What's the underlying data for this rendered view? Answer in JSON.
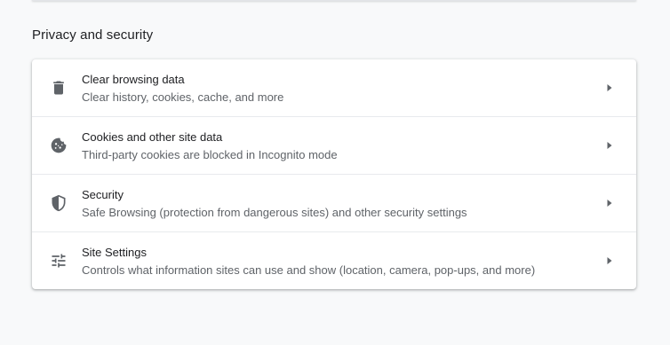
{
  "section": {
    "title": "Privacy and security"
  },
  "rows": [
    {
      "icon": "trash-icon",
      "label": "Clear browsing data",
      "sublabel": "Clear history, cookies, cache, and more"
    },
    {
      "icon": "cookie-icon",
      "label": "Cookies and other site data",
      "sublabel": "Third-party cookies are blocked in Incognito mode"
    },
    {
      "icon": "shield-icon",
      "label": "Security",
      "sublabel": "Safe Browsing (protection from dangerous sites) and other security settings"
    },
    {
      "icon": "tune-icon",
      "label": "Site Settings",
      "sublabel": "Controls what information sites can use and show (location, camera, pop-ups, and more)"
    }
  ],
  "colors": {
    "icon": "#5f6368",
    "text_primary": "#202124",
    "text_secondary": "#5f6368",
    "background": "#f8f9fa",
    "card": "#ffffff"
  }
}
